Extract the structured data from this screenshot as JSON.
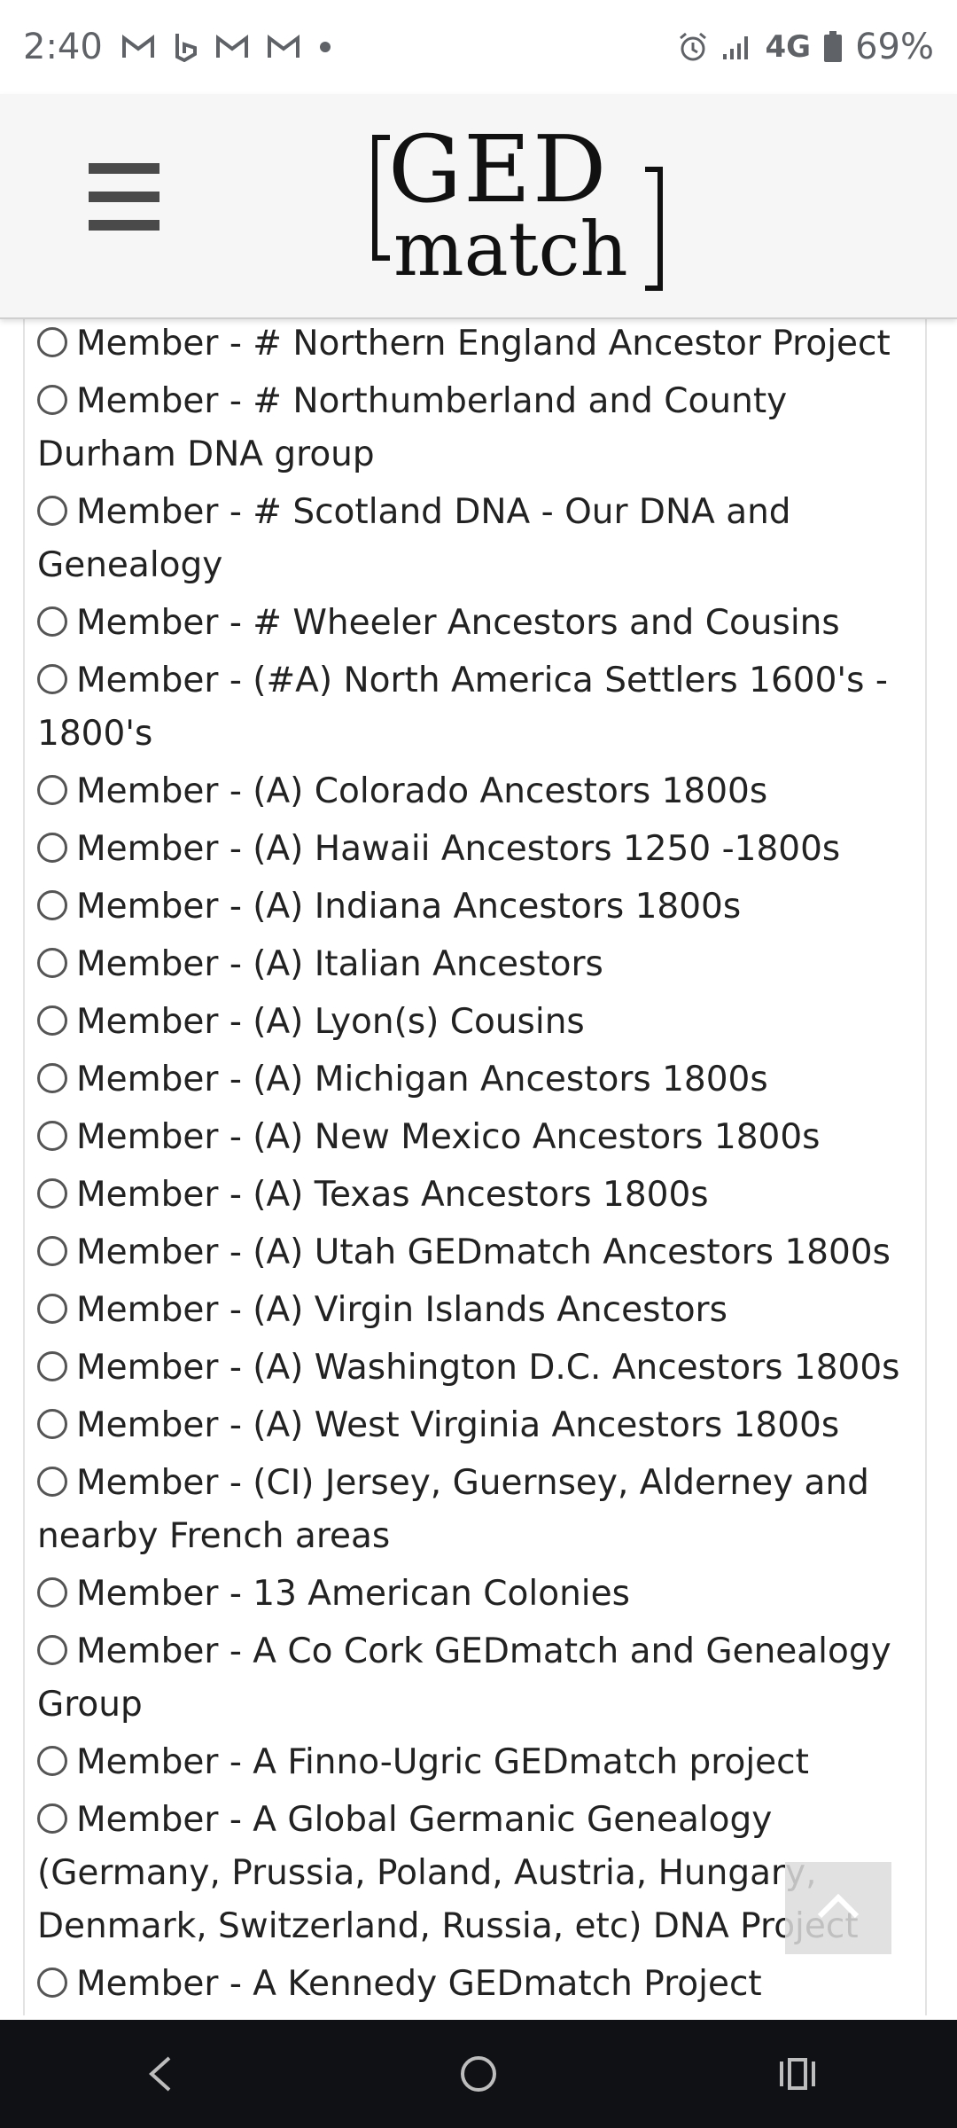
{
  "status_bar": {
    "time": "2:40",
    "network": "4G",
    "battery": "69%",
    "notification_icons": [
      "gmail-icon",
      "bing-icon",
      "gmail-icon",
      "gmail-icon",
      "dot-icon"
    ],
    "system_icons": [
      "alarm-icon",
      "signal-icon",
      "lte-icon",
      "battery-icon"
    ]
  },
  "header": {
    "logo_top": "GED",
    "logo_bottom": "match",
    "menu_icon": "hamburger-menu-icon"
  },
  "groups": [
    {
      "label": "Member - # Northern England Ancestor Project"
    },
    {
      "label": "Member - # Northumberland and County Durham DNA group"
    },
    {
      "label": "Member - # Scotland DNA - Our DNA and Genealogy"
    },
    {
      "label": "Member - # Wheeler Ancestors and Cousins"
    },
    {
      "label": "Member - (#A) North America Settlers 1600's - 1800's"
    },
    {
      "label": "Member - (A) Colorado Ancestors 1800s"
    },
    {
      "label": "Member - (A) Hawaii Ancestors 1250 -1800s"
    },
    {
      "label": "Member - (A) Indiana Ancestors 1800s"
    },
    {
      "label": "Member - (A) Italian Ancestors"
    },
    {
      "label": "Member - (A) Lyon(s) Cousins"
    },
    {
      "label": "Member - (A) Michigan Ancestors 1800s"
    },
    {
      "label": "Member - (A) New Mexico Ancestors 1800s"
    },
    {
      "label": "Member - (A) Texas Ancestors 1800s"
    },
    {
      "label": "Member - (A) Utah GEDmatch Ancestors 1800s"
    },
    {
      "label": "Member - (A) Virgin Islands Ancestors"
    },
    {
      "label": "Member - (A) Washington D.C. Ancestors 1800s"
    },
    {
      "label": "Member - (A) West Virginia Ancestors 1800s"
    },
    {
      "label": "Member - (CI) Jersey, Guernsey, Alderney and nearby French areas"
    },
    {
      "label": "Member - 13 American Colonies"
    },
    {
      "label": "Member - A Co Cork GEDmatch and Genealogy Group"
    },
    {
      "label": "Member - A Finno-Ugric GEDmatch project"
    },
    {
      "label": "Member - A Global Germanic Genealogy (Germany, Prussia, Poland, Austria, Hungary, Denmark, Switzerland, Russia, etc) DNA Project"
    },
    {
      "label": "Member - A Kennedy GEDmatch Project"
    }
  ],
  "controls": {
    "back_to_top_icon": "chevron-up-icon"
  },
  "nav_bar": {
    "back_icon": "back-icon",
    "home_icon": "home-icon",
    "recents_icon": "recents-icon"
  },
  "colors": {
    "header_bg": "#f6f6f6",
    "nav_bg": "#101114",
    "text": "#222222"
  }
}
